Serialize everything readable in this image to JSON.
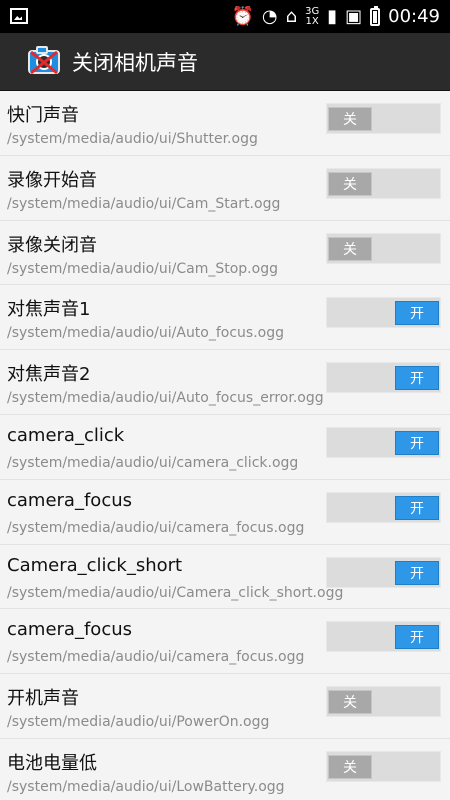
{
  "statusbar": {
    "time": "00:49",
    "network": "3G\n1X"
  },
  "app": {
    "title": "关闭相机声音"
  },
  "items": [
    {
      "title": "快门声音",
      "path": "/system/media/audio/ui/Shutter.ogg",
      "state": "关",
      "on": false
    },
    {
      "title": "录像开始音",
      "path": "/system/media/audio/ui/Cam_Start.ogg",
      "state": "关",
      "on": false
    },
    {
      "title": "录像关闭音",
      "path": "/system/media/audio/ui/Cam_Stop.ogg",
      "state": "关",
      "on": false
    },
    {
      "title": "对焦声音1",
      "path": "/system/media/audio/ui/Auto_focus.ogg",
      "state": "开",
      "on": true
    },
    {
      "title": "对焦声音2",
      "path": "/system/media/audio/ui/Auto_focus_error.ogg",
      "state": "开",
      "on": true
    },
    {
      "title": "camera_click",
      "path": "/system/media/audio/ui/camera_click.ogg",
      "state": "开",
      "on": true
    },
    {
      "title": "camera_focus",
      "path": "/system/media/audio/ui/camera_focus.ogg",
      "state": "开",
      "on": true
    },
    {
      "title": "Camera_click_short",
      "path": "/system/media/audio/ui/Camera_click_short.ogg",
      "state": "开",
      "on": true
    },
    {
      "title": "camera_focus",
      "path": "/system/media/audio/ui/camera_focus.ogg",
      "state": "开",
      "on": true
    },
    {
      "title": "开机声音",
      "path": "/system/media/audio/ui/PowerOn.ogg",
      "state": "关",
      "on": false
    },
    {
      "title": "电池电量低",
      "path": "/system/media/audio/ui/LowBattery.ogg",
      "state": "关",
      "on": false
    }
  ]
}
